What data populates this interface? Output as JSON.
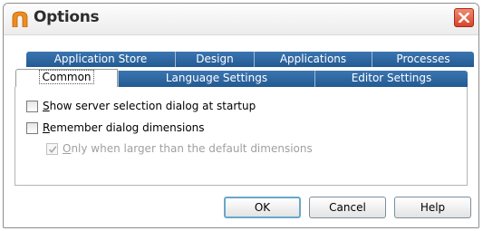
{
  "window": {
    "title": "Options",
    "close_label": "Close"
  },
  "tabs": {
    "row_back": [
      {
        "label": "Application Store",
        "selected": false
      },
      {
        "label": "Design",
        "selected": false
      },
      {
        "label": "Applications",
        "selected": false
      },
      {
        "label": "Processes",
        "selected": false
      }
    ],
    "row_front": [
      {
        "label": "Common",
        "selected": true
      },
      {
        "label": "Language Settings",
        "selected": false
      },
      {
        "label": "Editor Settings",
        "selected": false
      }
    ]
  },
  "options": {
    "show_server_selection": {
      "mnemonic": "S",
      "label_rest": "how server selection dialog at startup",
      "checked": false,
      "enabled": true
    },
    "remember_dimensions": {
      "mnemonic": "R",
      "label_rest": "emember dialog dimensions",
      "checked": false,
      "enabled": true
    },
    "only_when_larger": {
      "mnemonic": "O",
      "label_rest": "nly when larger than the default dimensions",
      "checked": true,
      "enabled": false
    }
  },
  "buttons": {
    "ok": "OK",
    "cancel": "Cancel",
    "help": "Help"
  },
  "colors": {
    "tab_blue": "#2d66a2",
    "close_red": "#d9452a",
    "app_icon_orange": "#f08c1c"
  }
}
